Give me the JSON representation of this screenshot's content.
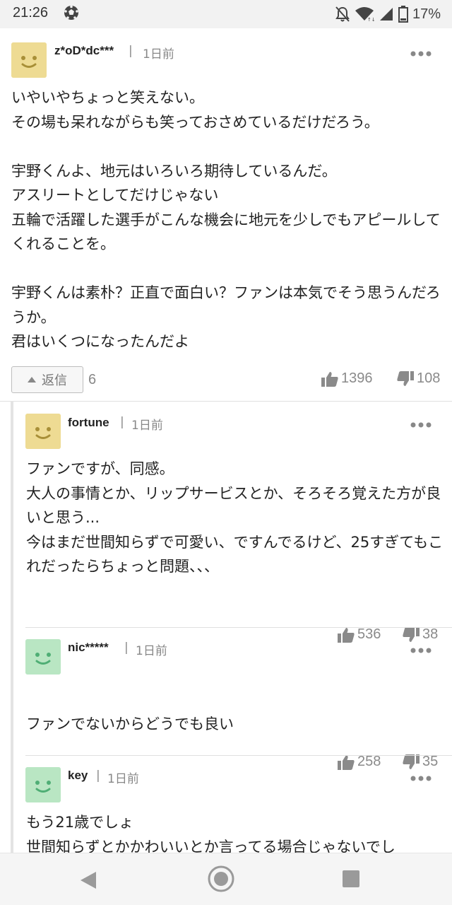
{
  "status_bar": {
    "time": "21:26",
    "battery": "17%",
    "icons": [
      "soccer-ball-icon",
      "notifications-off-icon",
      "wifi-icon",
      "signal-icon",
      "battery-icon"
    ]
  },
  "comments": [
    {
      "username": "z*oD*dc***",
      "time": "1日前",
      "body": "いやいやちょっと笑えない。\nその場も呆れながらも笑っておさめているだけだろう。\n\n宇野くんよ、地元はいろいろ期待しているんだ。\nアスリートとしてだけじゃない\n五輪で活躍した選手がこんな機会に地元を少しでもアピールしてくれることを。\n\n宇野くんは素朴？正直で面白い？ファンは本気でそう思うんだろうか。\n君はいくつになったんだよ",
      "reply_label": "返信",
      "reply_count": "6",
      "likes": "1396",
      "dislikes": "108",
      "avatar": "smiley-yellow"
    }
  ],
  "replies": [
    {
      "username": "fortune",
      "time": "1日前",
      "body": "ファンですが、同感。\n大人の事情とか、リップサービスとか、そろそろ覚えた方が良いと思う...\n今はまだ世間知らずで可愛い、ですんでるけど、25すぎてもこれだったらちょっと問題、、、",
      "likes": "536",
      "dislikes": "38",
      "avatar": "smiley-yellow"
    },
    {
      "username": "nic*****",
      "time": "1日前",
      "body": "ファンでないからどうでも良い",
      "likes": "258",
      "dislikes": "35",
      "avatar": "smiley-green"
    },
    {
      "username": "key",
      "time": "1日前",
      "body": "もう21歳でしょ\n世間知らずとかかわいいとか言ってる場合じゃないでし",
      "avatar": "smiley-green"
    }
  ],
  "separator": "|",
  "colors": {
    "avatar_yellow": "#eedb93",
    "avatar_green": "#b9e6c3",
    "muted_text": "#8a8a8a"
  }
}
